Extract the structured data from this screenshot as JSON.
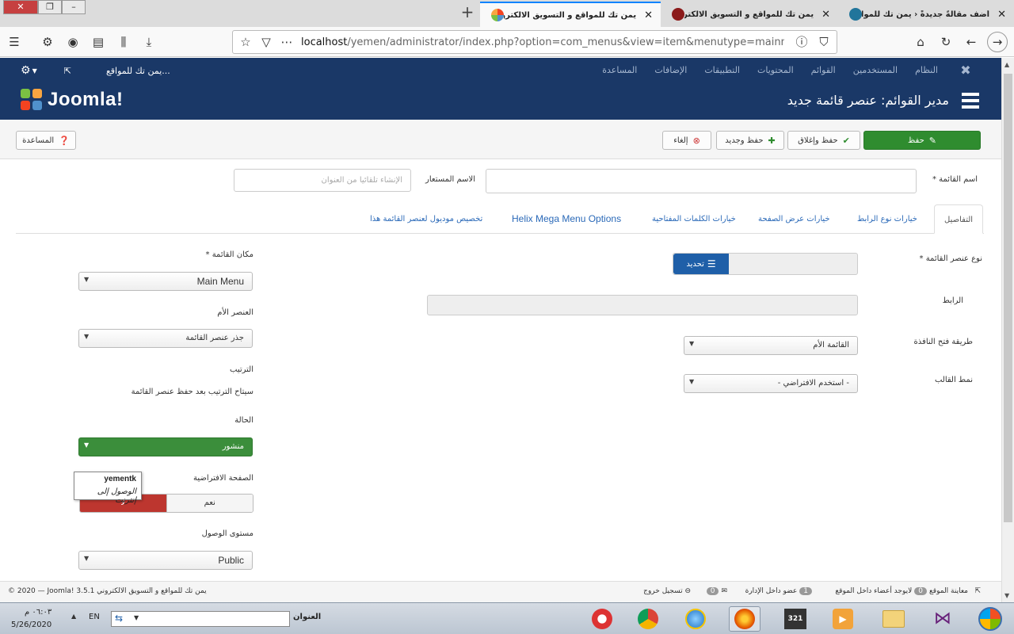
{
  "browser": {
    "tabs": [
      {
        "title": "يمن تك للمواقع و التسويق الالكتروني",
        "active": true
      },
      {
        "title": "يمن تك للمواقع و التسويق الالكتروني",
        "active": false
      },
      {
        "title": "أضف مقالةً جديدةً ‹ يمن تك للمواقع و",
        "active": false
      }
    ],
    "url_host": "localhost",
    "url_path": "/yemen/administrator/index.php?option=com_menus&view=item&menutype=mainmenu&"
  },
  "adminbar": {
    "menu": [
      "النظام",
      "المستخدمين",
      "القوائم",
      "المحتويات",
      "التطبيقات",
      "الإضافات",
      "المساعدة"
    ],
    "site_link": "يمن تك للمواقع..."
  },
  "header": {
    "logo_text": "Joomla!",
    "page_title": "مدير القوائم: عنصر قائمة جديد"
  },
  "toolbar": {
    "save": "حفظ",
    "save_close": "حفظ وإغلاق",
    "save_new": "حفظ وجديد",
    "cancel": "إلغاء",
    "help": "المساعدة"
  },
  "form": {
    "menu_title_label": "اسم القائمة *",
    "alias_label": "الاسم المستعار",
    "alias_placeholder": "الإنشاء تلقائيا من العنوان",
    "tabs": [
      "التفاصيل",
      "خيارات نوع الرابط",
      "خيارات عرض الصفحة",
      "خيارات الكلمات المفتاحية",
      "Helix Mega Menu Options",
      "تخصيص موديول لعنصر القائمة هذا"
    ],
    "item_type_label": "نوع عنصر القائمة *",
    "item_type_button": "تحديد",
    "link_label": "الرابط",
    "target_label": "طريقة فتح النافذة",
    "target_value": "القائمة الأم",
    "template_label": "نمط القالب",
    "template_value": "- استخدم الافتراضي -",
    "menu_label": "مكان القائمة *",
    "menu_value": "Main Menu",
    "parent_label": "العنصر الأم",
    "parent_value": "جذر عنصر القائمة",
    "ordering_label": "الترتيب",
    "ordering_text": "سيتاح الترتيب بعد حفظ عنصر القائمة",
    "status_label": "الحالة",
    "status_value": "منشور",
    "default_page_label": "الصفحة الافتراضية",
    "default_no": "لا",
    "default_yes": "نعم",
    "access_label": "مستوى الوصول",
    "access_value": "Public"
  },
  "tooltip": {
    "title": "yementk",
    "subtitle": "الوصول إلى إنترنت"
  },
  "statusbar": {
    "preview": "معاينة الموقع",
    "visitors_count": "0",
    "visitors": "لايوجد أعضاء داخل الموقع",
    "admins_count": "1",
    "admins": "عضو داخل الإدارة",
    "messages_count": "0",
    "logout": "تسجيل خروج",
    "copyright": "© 2020 — Joomla! 3.5.1 يمن تك للمواقع و التسويق الالكتروني"
  },
  "taskbar": {
    "address_label": "العنوان",
    "lang": "EN",
    "time": "٠٦:٠٣ م",
    "date": "5/26/2020"
  },
  "colors": {
    "joomla_blue": "#1a3867",
    "save_green": "#2f8c2f",
    "status_green": "#3b8e3b",
    "no_red": "#bd362f",
    "link_blue": "#2a69b8"
  }
}
